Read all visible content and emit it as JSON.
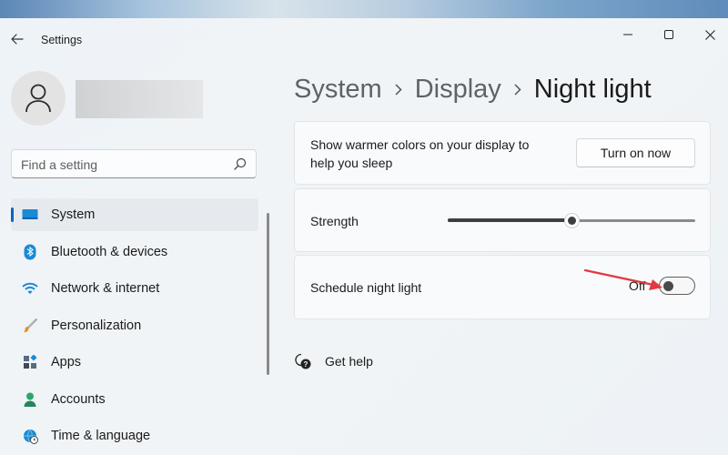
{
  "window": {
    "title": "Settings"
  },
  "search": {
    "placeholder": "Find a setting"
  },
  "sidebar": {
    "items": [
      {
        "label": "System",
        "icon": "display-icon",
        "selected": true
      },
      {
        "label": "Bluetooth & devices",
        "icon": "bluetooth-icon",
        "selected": false
      },
      {
        "label": "Network & internet",
        "icon": "wifi-icon",
        "selected": false
      },
      {
        "label": "Personalization",
        "icon": "brush-icon",
        "selected": false
      },
      {
        "label": "Apps",
        "icon": "apps-icon",
        "selected": false
      },
      {
        "label": "Accounts",
        "icon": "person-icon",
        "selected": false
      },
      {
        "label": "Time & language",
        "icon": "globe-clock-icon",
        "selected": false
      }
    ]
  },
  "breadcrumb": {
    "items": [
      "System",
      "Display",
      "Night light"
    ]
  },
  "cards": {
    "turn_on": {
      "description": "Show warmer colors on your display to help you sleep",
      "button_label": "Turn on now"
    },
    "strength": {
      "label": "Strength",
      "value_fraction": 0.5
    },
    "schedule": {
      "label": "Schedule night light",
      "state_label": "Off",
      "on": false
    }
  },
  "help": {
    "label": "Get help"
  },
  "colors": {
    "accent": "#0067c0",
    "annotation_arrow": "#e0393e"
  }
}
